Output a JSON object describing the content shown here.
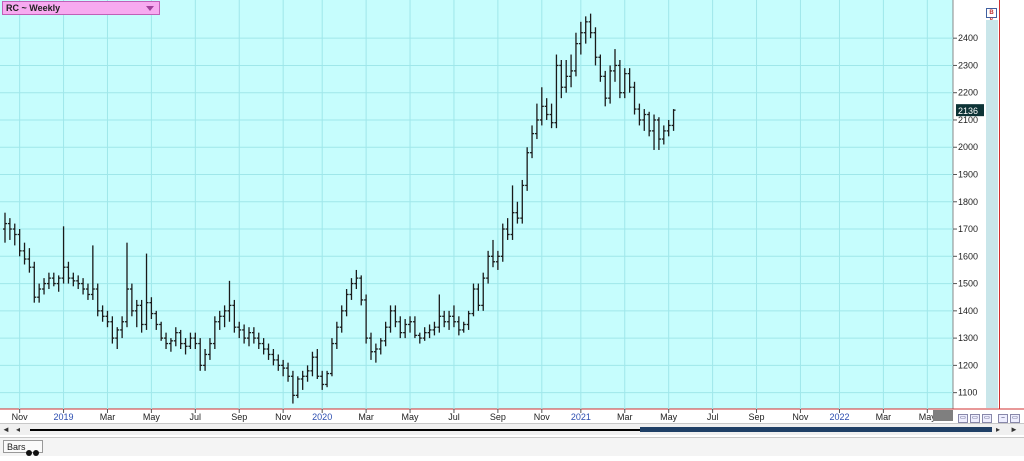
{
  "header": {
    "symbol_label": "RC ~ Weekly"
  },
  "footer": {
    "tab_label": "Bars"
  },
  "colors": {
    "plot_background": "#c6fdfd",
    "grid": "#9fe7ea",
    "bars": "#1a1a1a",
    "price_tag_bg": "#0d3336",
    "price_tag_text": "#ffffff",
    "right_border": "#d03030"
  },
  "icons": {
    "scroll_left": "◄",
    "scroll_step_left": "◂",
    "scroll_right": "►",
    "scroll_step_right": "▸",
    "dropdown": "chevron-down-icon"
  },
  "chart_data": {
    "type": "ohlc",
    "title": "RC ~ Weekly",
    "ylim": [
      1040,
      2540
    ],
    "y_ticks": [
      1100,
      1200,
      1300,
      1400,
      1500,
      1600,
      1700,
      1800,
      1900,
      2000,
      2100,
      2200,
      2300,
      2400
    ],
    "x_tick_labels": [
      "Nov",
      "2019",
      "Mar",
      "May",
      "Jul",
      "Sep",
      "Nov",
      "2020",
      "Mar",
      "May",
      "Jul",
      "Sep",
      "Nov",
      "2021",
      "Mar",
      "May",
      "Jul",
      "Sep",
      "Nov",
      "2022",
      "Mar",
      "May"
    ],
    "x_tick_weeks": [
      3,
      12,
      21,
      30,
      39,
      48,
      57,
      65,
      74,
      83,
      92,
      101,
      110,
      118,
      127,
      136,
      145,
      154,
      163,
      171,
      180,
      189
    ],
    "last_price": 2136,
    "grid": true,
    "bars": [
      [
        1700,
        1760,
        1650,
        1720
      ],
      [
        1720,
        1740,
        1660,
        1700
      ],
      [
        1700,
        1720,
        1640,
        1680
      ],
      [
        1680,
        1700,
        1600,
        1620
      ],
      [
        1620,
        1650,
        1570,
        1590
      ],
      [
        1590,
        1630,
        1540,
        1560
      ],
      [
        1560,
        1580,
        1430,
        1450
      ],
      [
        1450,
        1500,
        1430,
        1480
      ],
      [
        1480,
        1520,
        1460,
        1500
      ],
      [
        1500,
        1540,
        1480,
        1520
      ],
      [
        1520,
        1540,
        1490,
        1500
      ],
      [
        1500,
        1530,
        1470,
        1520
      ],
      [
        1520,
        1710,
        1500,
        1560
      ],
      [
        1560,
        1580,
        1500,
        1520
      ],
      [
        1520,
        1540,
        1490,
        1510
      ],
      [
        1510,
        1530,
        1480,
        1500
      ],
      [
        1500,
        1520,
        1460,
        1480
      ],
      [
        1480,
        1500,
        1440,
        1460
      ],
      [
        1460,
        1640,
        1440,
        1480
      ],
      [
        1480,
        1500,
        1380,
        1400
      ],
      [
        1400,
        1420,
        1360,
        1380
      ],
      [
        1380,
        1400,
        1340,
        1360
      ],
      [
        1360,
        1380,
        1280,
        1300
      ],
      [
        1300,
        1340,
        1260,
        1330
      ],
      [
        1330,
        1380,
        1300,
        1360
      ],
      [
        1360,
        1650,
        1340,
        1480
      ],
      [
        1480,
        1500,
        1380,
        1400
      ],
      [
        1400,
        1440,
        1340,
        1420
      ],
      [
        1420,
        1440,
        1320,
        1350
      ],
      [
        1350,
        1610,
        1330,
        1430
      ],
      [
        1430,
        1450,
        1370,
        1390
      ],
      [
        1390,
        1400,
        1330,
        1350
      ],
      [
        1350,
        1360,
        1290,
        1300
      ],
      [
        1300,
        1320,
        1260,
        1280
      ],
      [
        1280,
        1300,
        1250,
        1290
      ],
      [
        1290,
        1340,
        1270,
        1320
      ],
      [
        1320,
        1330,
        1260,
        1280
      ],
      [
        1280,
        1300,
        1240,
        1270
      ],
      [
        1270,
        1320,
        1260,
        1300
      ],
      [
        1300,
        1320,
        1260,
        1280
      ],
      [
        1280,
        1300,
        1180,
        1200
      ],
      [
        1200,
        1260,
        1180,
        1240
      ],
      [
        1240,
        1300,
        1220,
        1280
      ],
      [
        1280,
        1380,
        1260,
        1360
      ],
      [
        1360,
        1400,
        1330,
        1380
      ],
      [
        1380,
        1420,
        1340,
        1400
      ],
      [
        1400,
        1510,
        1360,
        1420
      ],
      [
        1420,
        1440,
        1320,
        1340
      ],
      [
        1340,
        1360,
        1300,
        1330
      ],
      [
        1330,
        1350,
        1280,
        1300
      ],
      [
        1300,
        1340,
        1270,
        1320
      ],
      [
        1320,
        1340,
        1280,
        1300
      ],
      [
        1300,
        1320,
        1260,
        1280
      ],
      [
        1280,
        1300,
        1240,
        1260
      ],
      [
        1260,
        1280,
        1220,
        1240
      ],
      [
        1240,
        1260,
        1200,
        1220
      ],
      [
        1220,
        1240,
        1180,
        1200
      ],
      [
        1200,
        1220,
        1160,
        1190
      ],
      [
        1190,
        1210,
        1140,
        1160
      ],
      [
        1160,
        1180,
        1060,
        1090
      ],
      [
        1090,
        1160,
        1080,
        1150
      ],
      [
        1150,
        1180,
        1110,
        1160
      ],
      [
        1160,
        1200,
        1140,
        1180
      ],
      [
        1180,
        1250,
        1160,
        1230
      ],
      [
        1230,
        1260,
        1150,
        1160
      ],
      [
        1160,
        1180,
        1110,
        1130
      ],
      [
        1130,
        1180,
        1120,
        1170
      ],
      [
        1170,
        1300,
        1160,
        1280
      ],
      [
        1280,
        1360,
        1260,
        1340
      ],
      [
        1340,
        1420,
        1320,
        1400
      ],
      [
        1400,
        1480,
        1380,
        1460
      ],
      [
        1460,
        1520,
        1440,
        1500
      ],
      [
        1500,
        1550,
        1480,
        1520
      ],
      [
        1520,
        1530,
        1420,
        1440
      ],
      [
        1440,
        1460,
        1280,
        1300
      ],
      [
        1300,
        1320,
        1220,
        1250
      ],
      [
        1250,
        1280,
        1210,
        1260
      ],
      [
        1260,
        1300,
        1240,
        1290
      ],
      [
        1290,
        1360,
        1270,
        1340
      ],
      [
        1340,
        1420,
        1320,
        1400
      ],
      [
        1400,
        1420,
        1340,
        1360
      ],
      [
        1360,
        1380,
        1300,
        1320
      ],
      [
        1320,
        1370,
        1300,
        1350
      ],
      [
        1350,
        1380,
        1320,
        1360
      ],
      [
        1360,
        1380,
        1300,
        1310
      ],
      [
        1310,
        1320,
        1280,
        1300
      ],
      [
        1300,
        1340,
        1290,
        1320
      ],
      [
        1320,
        1350,
        1300,
        1330
      ],
      [
        1330,
        1360,
        1310,
        1340
      ],
      [
        1340,
        1460,
        1320,
        1380
      ],
      [
        1380,
        1400,
        1340,
        1360
      ],
      [
        1360,
        1400,
        1330,
        1380
      ],
      [
        1380,
        1420,
        1340,
        1360
      ],
      [
        1360,
        1380,
        1310,
        1330
      ],
      [
        1330,
        1360,
        1320,
        1350
      ],
      [
        1350,
        1400,
        1330,
        1390
      ],
      [
        1390,
        1500,
        1380,
        1480
      ],
      [
        1480,
        1500,
        1400,
        1420
      ],
      [
        1420,
        1540,
        1400,
        1520
      ],
      [
        1520,
        1620,
        1500,
        1600
      ],
      [
        1600,
        1660,
        1560,
        1580
      ],
      [
        1580,
        1620,
        1550,
        1600
      ],
      [
        1600,
        1720,
        1580,
        1700
      ],
      [
        1700,
        1740,
        1660,
        1680
      ],
      [
        1680,
        1860,
        1660,
        1760
      ],
      [
        1760,
        1800,
        1720,
        1740
      ],
      [
        1740,
        1880,
        1720,
        1860
      ],
      [
        1860,
        2000,
        1840,
        1980
      ],
      [
        1980,
        2080,
        1960,
        2050
      ],
      [
        2050,
        2160,
        2030,
        2100
      ],
      [
        2100,
        2220,
        2080,
        2150
      ],
      [
        2150,
        2180,
        2100,
        2120
      ],
      [
        2120,
        2160,
        2070,
        2090
      ],
      [
        2090,
        2340,
        2070,
        2300
      ],
      [
        2300,
        2320,
        2180,
        2220
      ],
      [
        2220,
        2320,
        2200,
        2260
      ],
      [
        2260,
        2340,
        2220,
        2280
      ],
      [
        2280,
        2420,
        2260,
        2380
      ],
      [
        2380,
        2460,
        2340,
        2420
      ],
      [
        2420,
        2480,
        2380,
        2460
      ],
      [
        2460,
        2490,
        2400,
        2420
      ],
      [
        2420,
        2440,
        2300,
        2330
      ],
      [
        2330,
        2340,
        2240,
        2260
      ],
      [
        2260,
        2280,
        2150,
        2180
      ],
      [
        2180,
        2300,
        2160,
        2280
      ],
      [
        2280,
        2360,
        2240,
        2300
      ],
      [
        2300,
        2320,
        2180,
        2200
      ],
      [
        2200,
        2290,
        2180,
        2270
      ],
      [
        2270,
        2290,
        2200,
        2220
      ],
      [
        2220,
        2240,
        2120,
        2140
      ],
      [
        2140,
        2160,
        2080,
        2100
      ],
      [
        2100,
        2140,
        2060,
        2120
      ],
      [
        2120,
        2130,
        2040,
        2060
      ],
      [
        2060,
        2120,
        1990,
        2100
      ],
      [
        2100,
        2110,
        1990,
        2030
      ],
      [
        2030,
        2080,
        2010,
        2060
      ],
      [
        2060,
        2100,
        2040,
        2080
      ],
      [
        2080,
        2140,
        2060,
        2136
      ]
    ]
  }
}
